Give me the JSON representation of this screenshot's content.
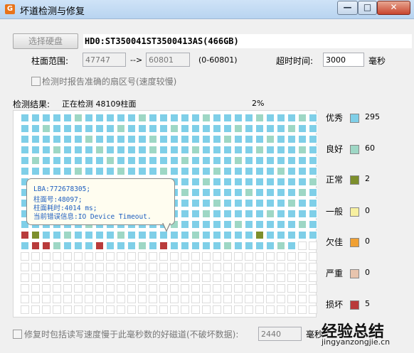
{
  "window": {
    "title": "坏道检测与修复",
    "app_icon": "G",
    "controls": {
      "minimize": "—",
      "maximize": "□",
      "close": "✕"
    }
  },
  "toolbar": {
    "select_disk_label": "选择硬盘",
    "drive_info": "HD0:ST350041ST3500413AS(466GB)"
  },
  "cylinder": {
    "label": "柱面范围:",
    "start": "47747",
    "arrow": "-->",
    "end": "60801",
    "range_hint": "(0-60801)"
  },
  "timeout": {
    "label": "超时时间:",
    "value": "3000",
    "unit": "毫秒"
  },
  "report_option": {
    "label": "检测时报告准确的扇区号(速度较慢)",
    "checked": false
  },
  "result": {
    "label": "检测结果:",
    "status": "正在检测 48109柱面",
    "percent": "2%"
  },
  "legend": [
    {
      "name": "优秀",
      "count": "295",
      "color": "#7fcfe8"
    },
    {
      "name": "良好",
      "count": "60",
      "color": "#9ed7c5"
    },
    {
      "name": "正常",
      "count": "2",
      "color": "#7d8f2c"
    },
    {
      "name": "一般",
      "count": "0",
      "color": "#f7f0a0"
    },
    {
      "name": "欠佳",
      "count": "0",
      "color": "#f0a033"
    },
    {
      "name": "严重",
      "count": "0",
      "color": "#e8c4ad"
    },
    {
      "name": "损坏",
      "count": "5",
      "color": "#b93b3b"
    }
  ],
  "tooltip": {
    "lba": "LBA:772678305;",
    "cylinder": "柱面号:48097;",
    "time": "柱面耗时:4014 ms;",
    "error": "当前错误信息:IO Device Timeout."
  },
  "repair_option": {
    "label": "修复时包括读写速度慢于此毫秒数的好磁道(不破坏数据):",
    "value": "2440",
    "unit_partial": "毫秒",
    "checked": false
  },
  "watermark": {
    "main": "经验总结",
    "url": "jingyanzongjie.cn"
  }
}
